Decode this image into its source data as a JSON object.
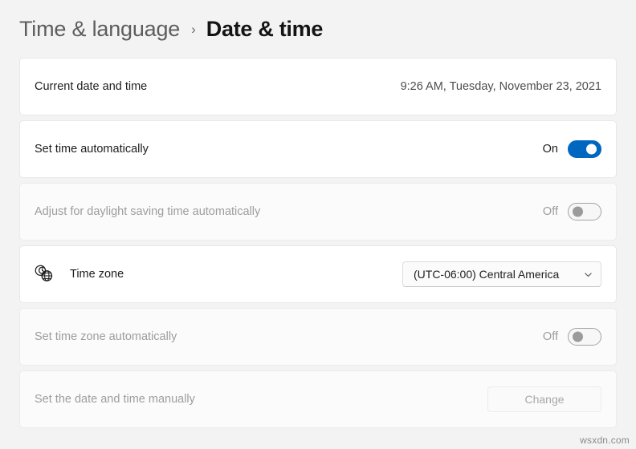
{
  "breadcrumb": {
    "parent": "Time & language",
    "separator": "›",
    "current": "Date & time"
  },
  "rows": [
    {
      "label": "Current date and time",
      "value": "9:26 AM, Tuesday, November 23, 2021"
    },
    {
      "label": "Set time automatically",
      "toggle_state": "On"
    },
    {
      "label": "Adjust for daylight saving time automatically",
      "toggle_state": "Off"
    },
    {
      "label": "Time zone",
      "icon": "time-zone-globe-clock-icon",
      "dropdown_value": "(UTC-06:00) Central America",
      "dropdown_icon": "chevron-down-icon"
    },
    {
      "label": "Set time zone automatically",
      "toggle_state": "Off"
    },
    {
      "label": "Set the date and time manually",
      "button_label": "Change"
    }
  ],
  "colors": {
    "accent": "#0067C0",
    "page_background": "#F3F3F3",
    "card_background": "#FFFFFF",
    "disabled_text": "#9D9D9D"
  },
  "watermark": "wsxdn.com"
}
